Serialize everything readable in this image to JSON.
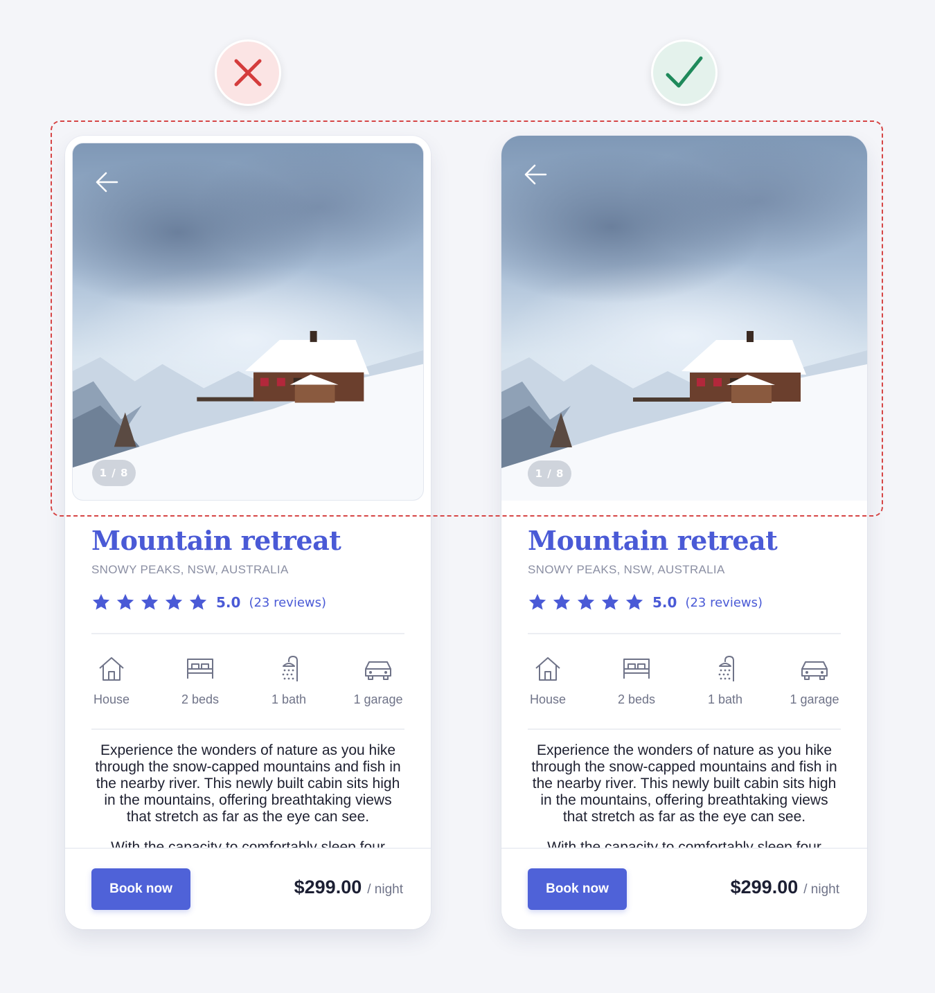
{
  "verdicts": {
    "bad": {
      "icon": "cross-icon",
      "color": "#d43c3c"
    },
    "good": {
      "icon": "checkmark-icon",
      "color": "#1f8a5b"
    }
  },
  "cards": {
    "bad": {
      "image_counter": "1 / 8",
      "title": "Mountain retreat",
      "location": "SNOWY PEAKS, NSW, AUSTRALIA",
      "rating": {
        "stars": 5,
        "score": "5.0",
        "reviews": "(23 reviews)"
      },
      "features": [
        "House",
        "2 beds",
        "1 bath",
        "1 garage"
      ],
      "description": "Experience the wonders of nature as you hike through the snow-capped mountains and fish in the nearby river. This newly built cabin sits high in the mountains, offering breathtaking views that stretch as far as the eye can see.",
      "description_cut": "With the capacity to comfortably sleep four",
      "book_label": "Book now",
      "price": "$299.00",
      "price_unit": "/ night"
    },
    "good": {
      "image_counter": "1 / 8",
      "title": "Mountain retreat",
      "location": "SNOWY PEAKS, NSW, AUSTRALIA",
      "rating": {
        "stars": 5,
        "score": "5.0",
        "reviews": "(23 reviews)"
      },
      "features": [
        "House",
        "2 beds",
        "1 bath",
        "1 garage"
      ],
      "description": "Experience the wonders of nature as you hike through the snow-capped mountains and fish in the nearby river. This newly built cabin sits high in the mountains, offering breathtaking views that stretch as far as the eye can see.",
      "description_cut": "With the capacity to comfortably sleep four",
      "book_label": "Book now",
      "price": "$299.00",
      "price_unit": "/ night"
    }
  },
  "colors": {
    "accent": "#4a5ad6",
    "button": "#4f62d8",
    "highlight": "#d64545",
    "background": "#f4f5f9"
  }
}
